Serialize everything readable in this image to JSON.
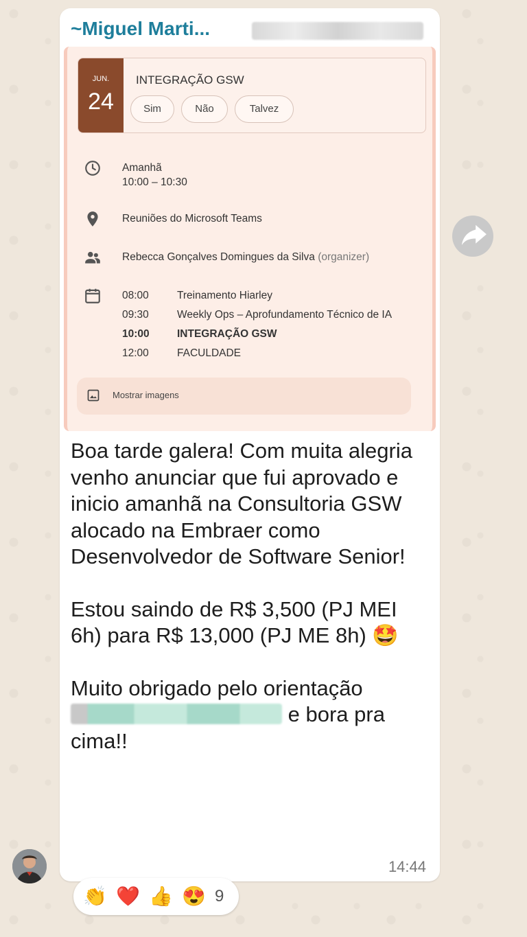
{
  "message": {
    "sender": "~Miguel Marti...",
    "time": "14:44",
    "paragraphs": [
      "Boa tarde galera! Com muita alegria venho anunciar que fui aprovado e inicio amanhã na Consultoria GSW alocado na Embraer como Desenvolvedor de Software Senior!",
      "Estou saindo de R$ 3,500 (PJ MEI 6h) para R$ 13,000 (PJ ME 8h) 🤩",
      "Muito obrigado pelo orientação",
      "e bora pra cima!!"
    ]
  },
  "event": {
    "month": "JUN.",
    "day": "24",
    "title": "INTEGRAÇÃO GSW",
    "rsvp": [
      "Sim",
      "Não",
      "Talvez"
    ],
    "when_day": "Amanhã",
    "when_time": "10:00 – 10:30",
    "location": "Reuniões do Microsoft Teams",
    "organizer_name": "Rebecca Gonçalves Domingues da Silva",
    "organizer_tag": "(organizer)",
    "agenda": [
      {
        "time": "08:00",
        "title": "Treinamento Hiarley"
      },
      {
        "time": "09:30",
        "title": "Weekly Ops – Aprofundamento Técnico de IA"
      },
      {
        "time": "10:00",
        "title": "INTEGRAÇÃO GSW"
      },
      {
        "time": "12:00",
        "title": "FACULDADE"
      }
    ],
    "show_images": "Mostrar imagens"
  },
  "reactions": {
    "emojis": [
      "👏",
      "❤️",
      "👍",
      "😍"
    ],
    "count": "9"
  },
  "colors": {
    "sender": "#1e7e9b",
    "date_block": "#8a4a2c",
    "bubble": "#ffffff",
    "wallpaper": "#efe7dc"
  }
}
